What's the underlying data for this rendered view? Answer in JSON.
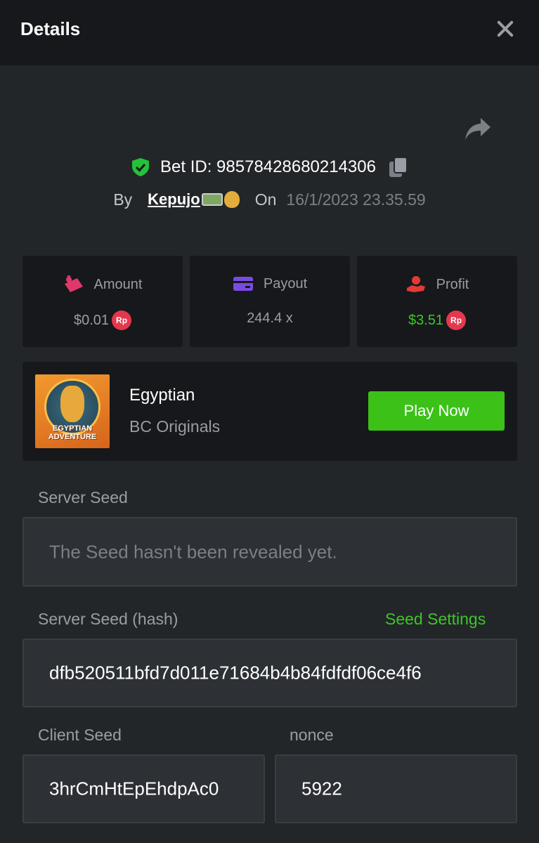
{
  "header": {
    "title": "Details"
  },
  "bet": {
    "id_text": "Bet ID: 98578428680214306",
    "by_label": "By",
    "username": "Kepujo",
    "on_label": "On",
    "date": "16/1/2023 23.35.59"
  },
  "stats": [
    {
      "label": "Amount",
      "value": "$0.01",
      "currency_badge": "Rp",
      "icon": "amount-icon"
    },
    {
      "label": "Payout",
      "value": "244.4 x",
      "icon": "card-icon"
    },
    {
      "label": "Profit",
      "value": "$3.51",
      "currency_badge": "Rp",
      "icon": "profit-hand-icon"
    }
  ],
  "game": {
    "name": "Egyptian",
    "provider": "BC Originals",
    "thumb_text_line1": "EGYPTIAN",
    "thumb_text_line2": "ADVENTURE",
    "play_label": "Play Now"
  },
  "seeds": {
    "server_seed_label": "Server Seed",
    "server_seed_placeholder": "The Seed hasn't been revealed yet.",
    "server_hash_label": "Server Seed (hash)",
    "seed_settings_label": "Seed Settings",
    "server_hash_value": "dfb520511bfd7d011e71684b4b84fdfdf06ce4f6",
    "client_seed_label": "Client Seed",
    "client_seed_value": "3hrCmHtEpEhdpAc0",
    "nonce_label": "nonce",
    "nonce_value": "5922"
  },
  "colors": {
    "accent_green": "#3bc117",
    "badge_red": "#e3384e",
    "shield_green": "#24c23a"
  }
}
